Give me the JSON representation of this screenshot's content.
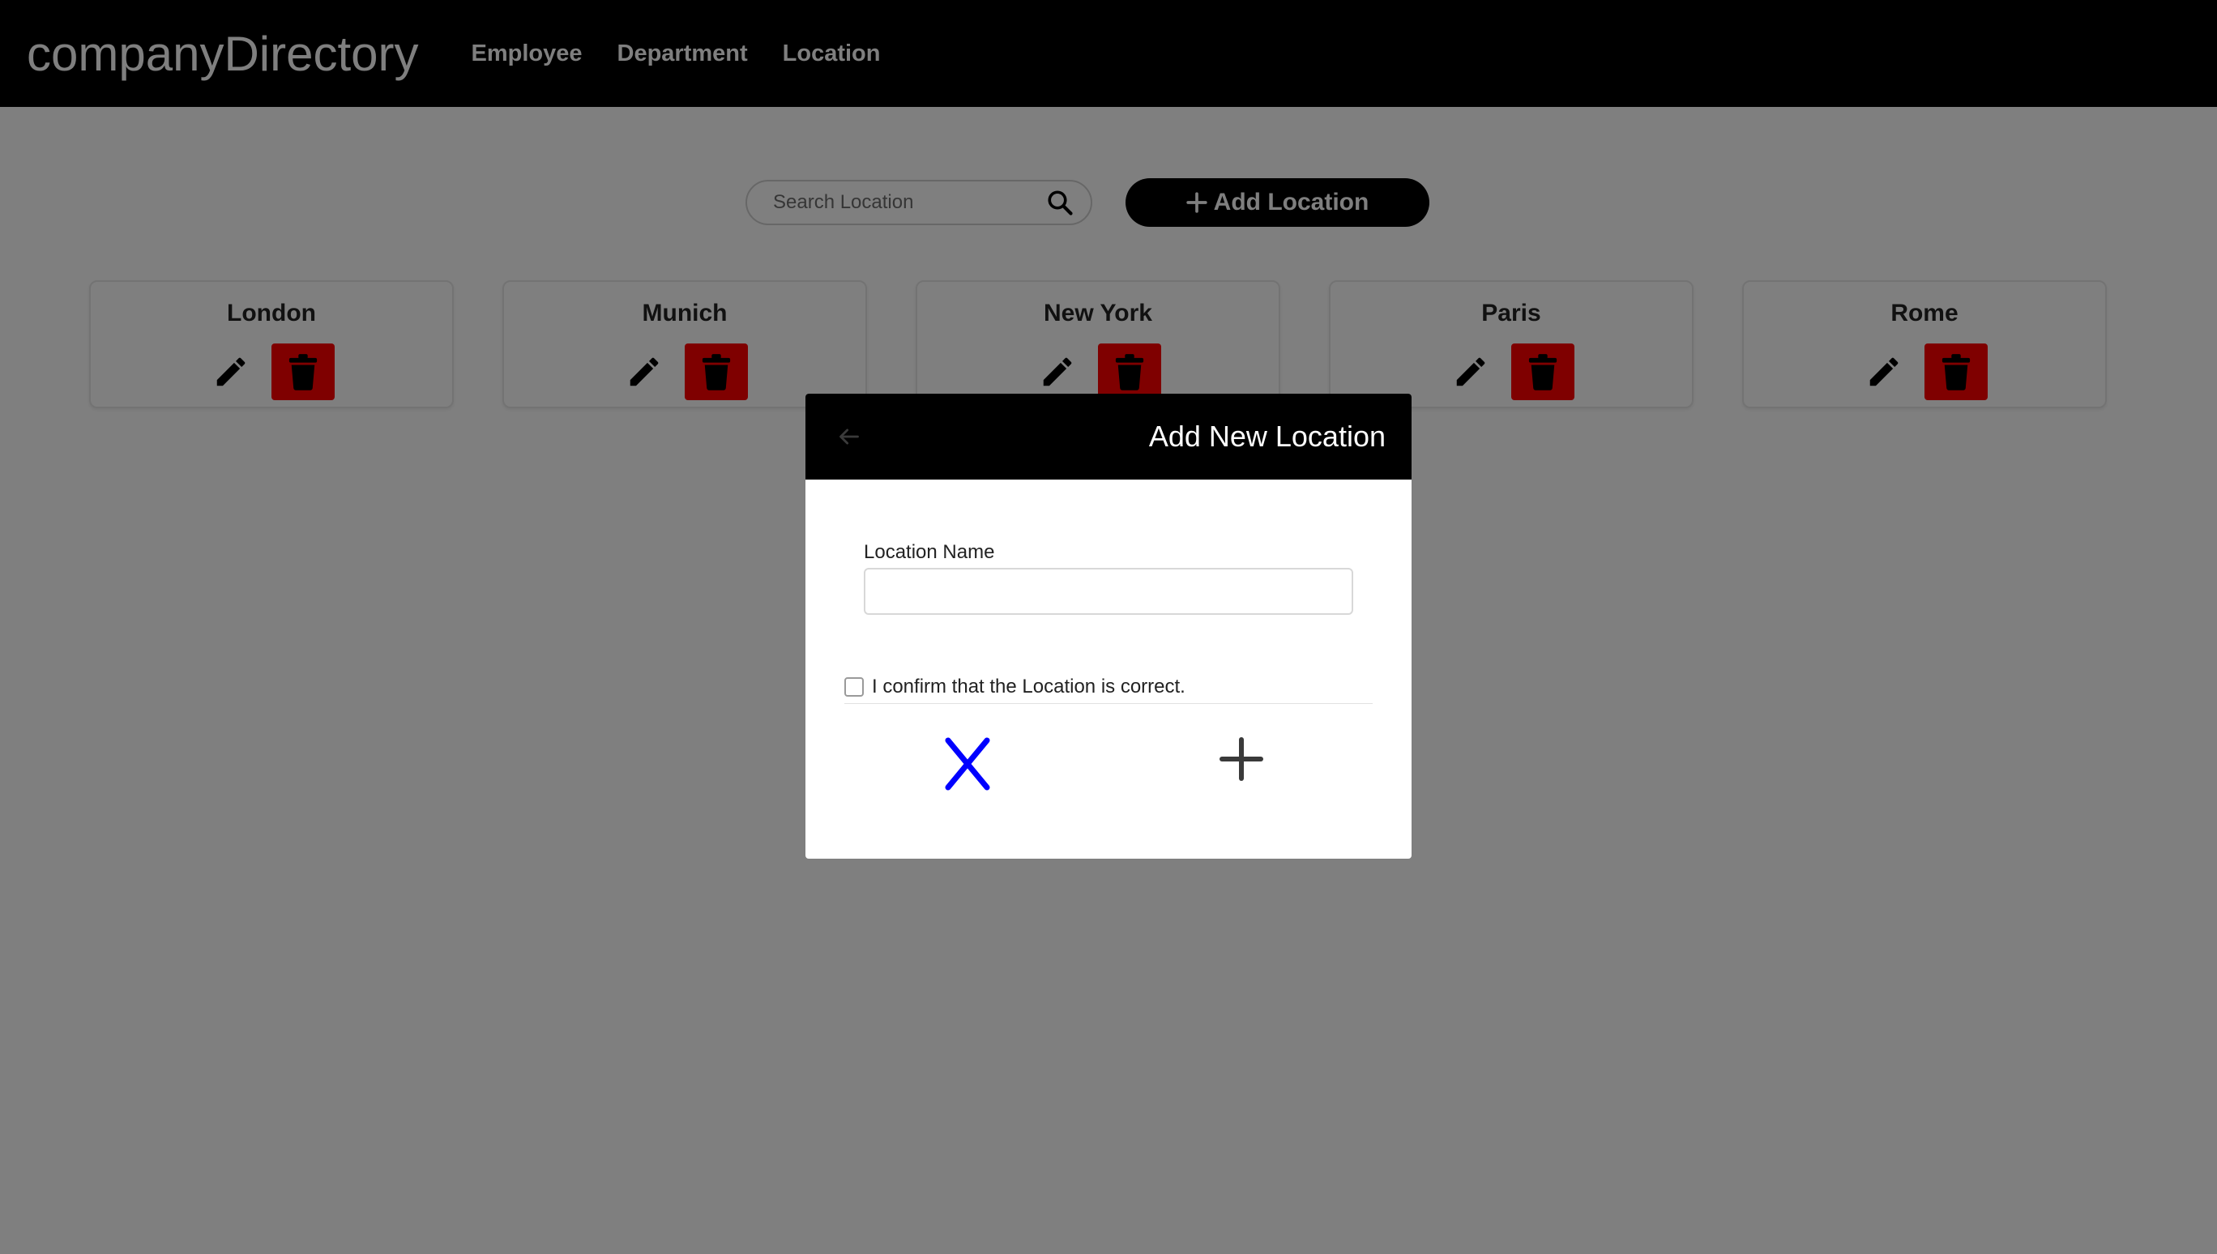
{
  "navbar": {
    "brand": "companyDirectory",
    "links": [
      "Employee",
      "Department",
      "Location"
    ]
  },
  "toolbar": {
    "search_placeholder": "Search Location",
    "add_button_label": "Add Location"
  },
  "locations": [
    {
      "name": "London"
    },
    {
      "name": "Munich"
    },
    {
      "name": "New York"
    },
    {
      "name": "Paris"
    },
    {
      "name": "Rome"
    }
  ],
  "modal": {
    "title": "Add New Location",
    "field_label": "Location Name",
    "field_value": "",
    "confirm_text": "I confirm that the Location is correct."
  },
  "colors": {
    "navbar_bg": "#000000",
    "delete_bg": "#ff0000",
    "cancel_icon": "#0000ff",
    "overlay": "rgba(0,0,0,0.5)"
  },
  "icons": [
    "search-icon",
    "plus-icon",
    "pencil-icon",
    "trash-icon",
    "arrow-left-icon",
    "close-x-icon"
  ]
}
